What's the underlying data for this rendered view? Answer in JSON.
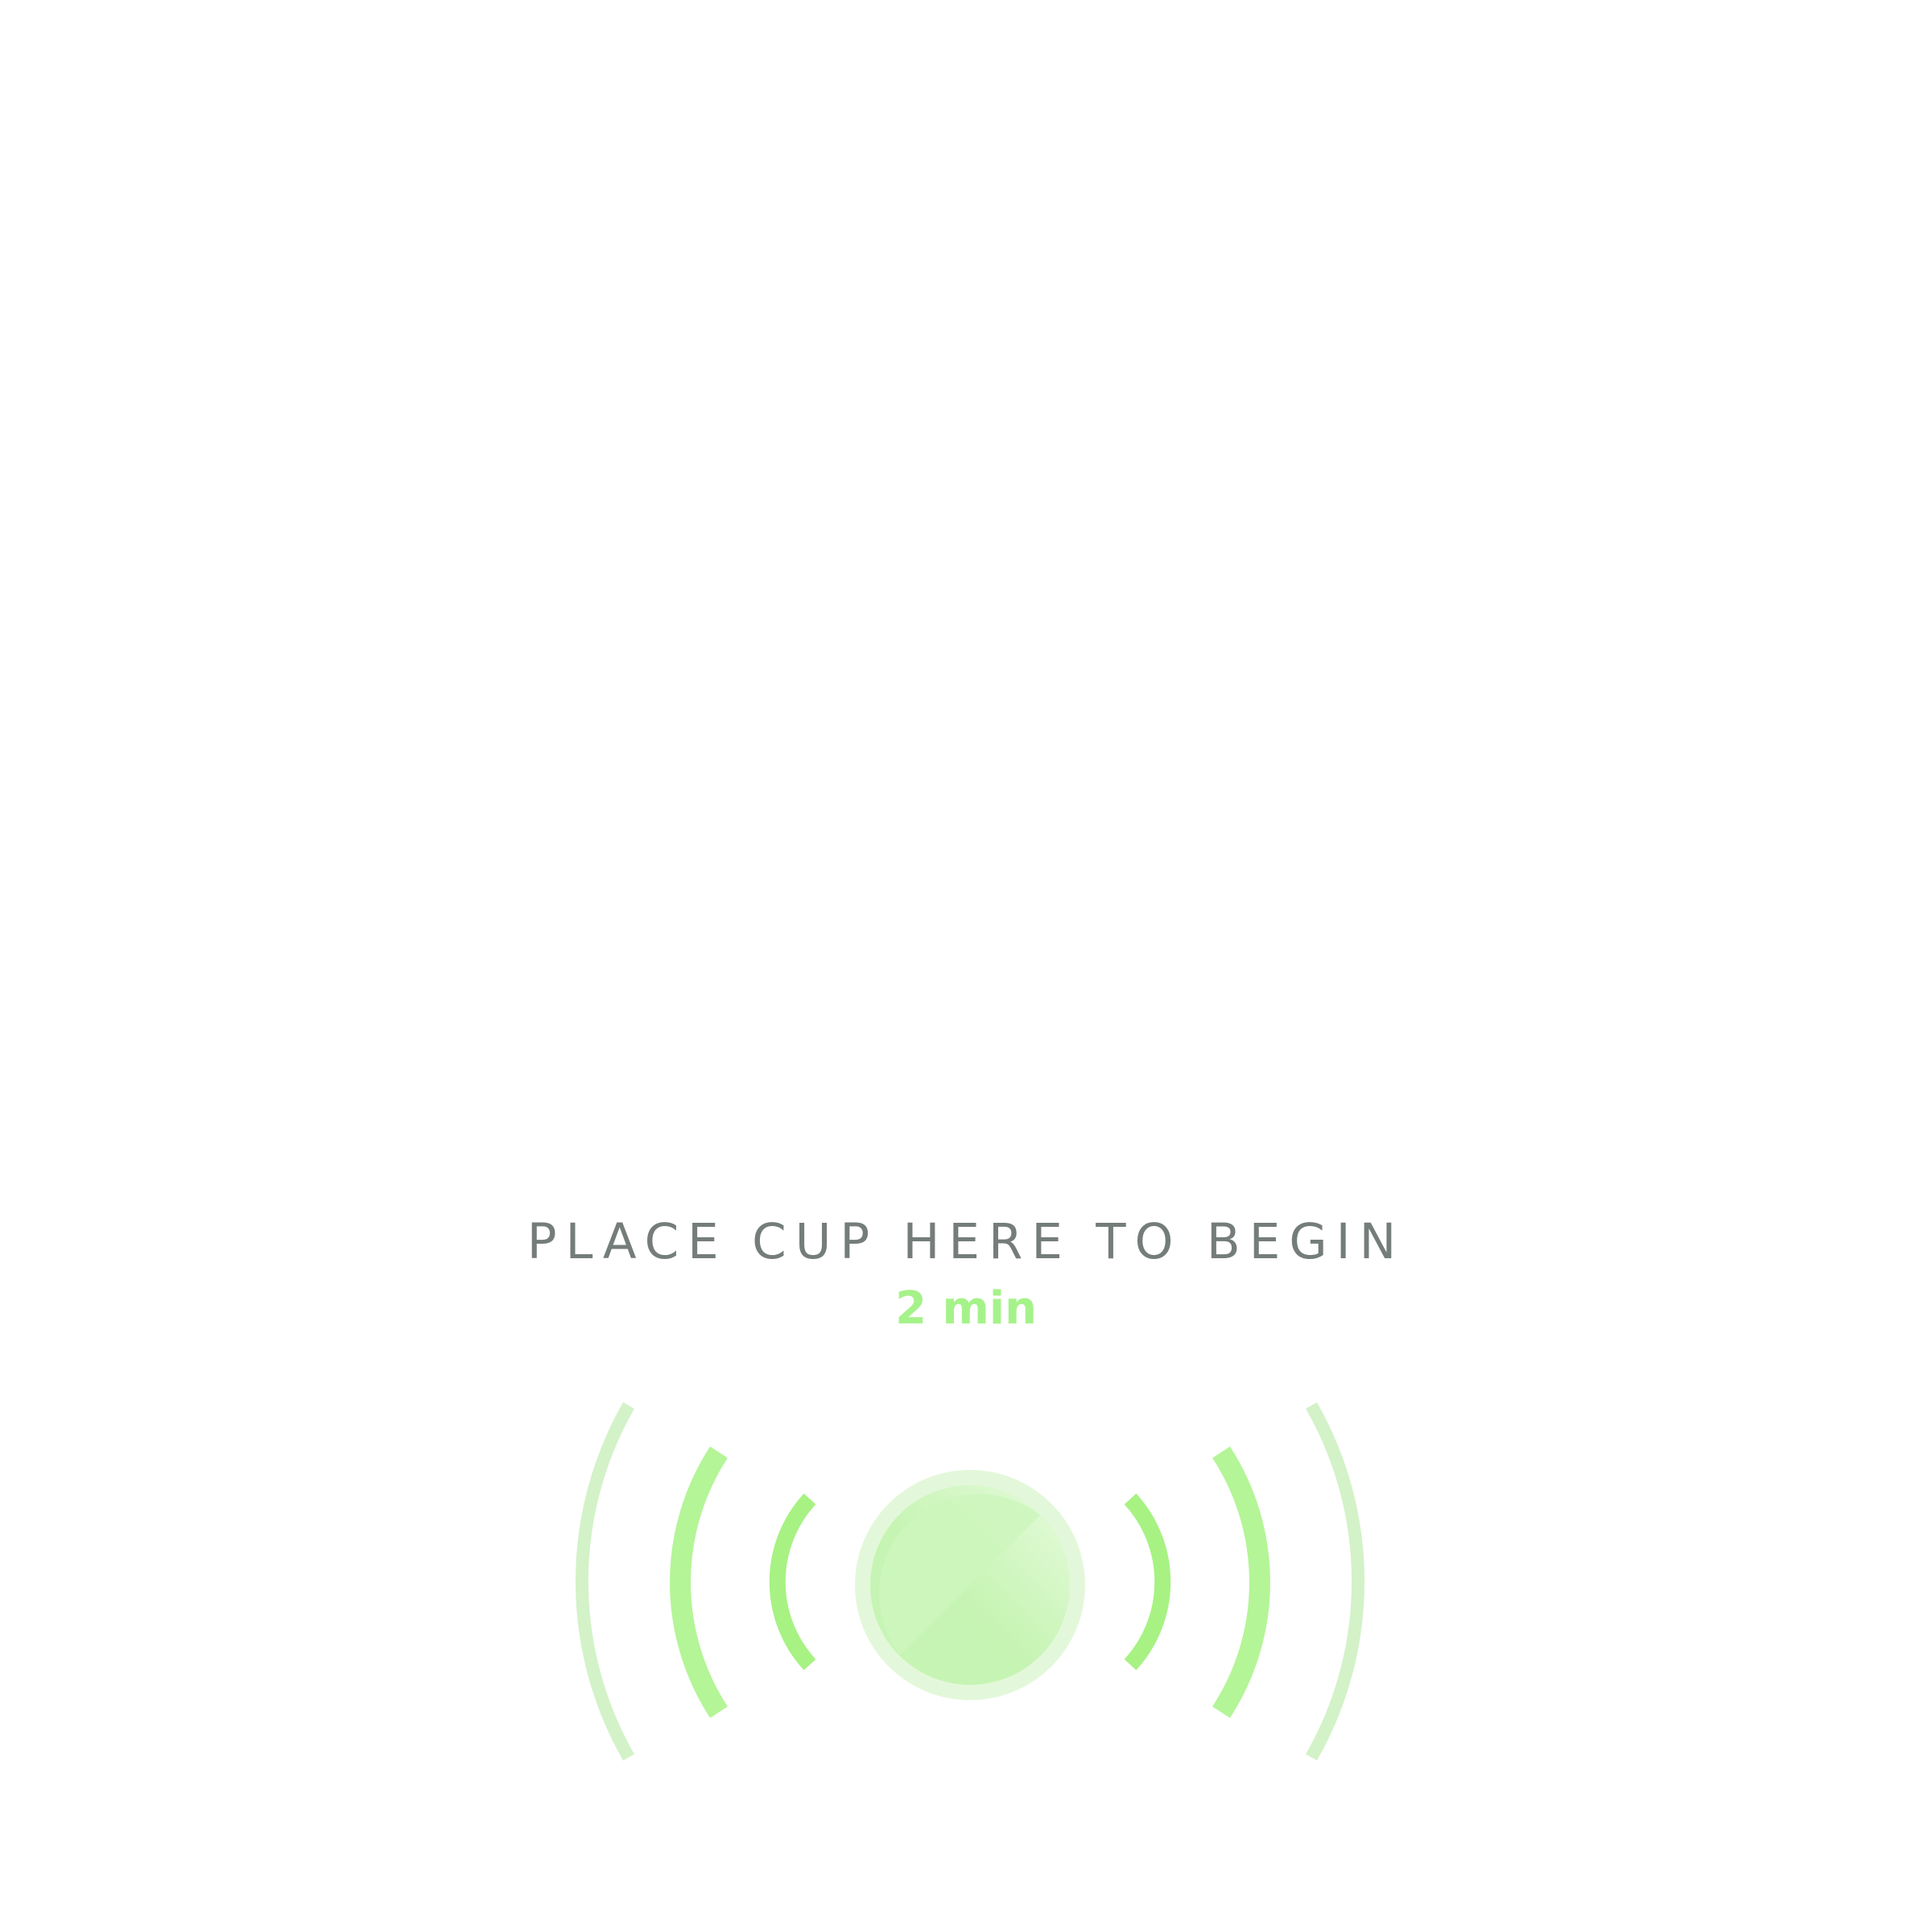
{
  "prompt": {
    "text": "PLACE CUP HERE TO BEGIN",
    "duration": "2 min"
  },
  "icons": {
    "cup_target": "cup-target-icon",
    "signal_waves": "signal-waves-icon"
  },
  "colors": {
    "prompt_text": "#757d7a",
    "accent_green": "#a6f28a",
    "wave_inner": "#a7f283",
    "wave_mid": "#b4f597",
    "wave_outer": "#d3f2c8",
    "target_light": "#e3f7db",
    "target_fill": "#c9f5b7"
  }
}
